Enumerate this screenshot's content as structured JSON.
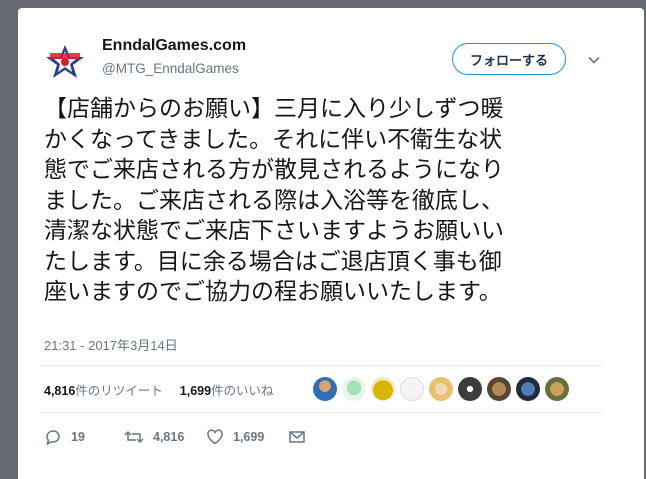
{
  "tweet": {
    "display_name": "EnndalGames.com",
    "handle": "@MTG_EnndalGames",
    "follow_label": "フォローする",
    "text_lines": [
      "【店舗からのお願い】三月に入り少しずつ暖",
      "かくなってきました。それに伴い不衛生な状",
      "態でご来店される方が散見されるようになり",
      "ました。ご来店される際は入浴等を徹底し、",
      "清潔な状態でご来店下さいますようお願いい",
      "たします。目に余る場合はご退店頂く事も御",
      "座いますのでご協力の程お願いいたします。"
    ],
    "timestamp": "21:31 - 2017年3月14日",
    "retweets_count": "4,816",
    "retweets_label": "件のリツイート",
    "likes_count": "1,699",
    "likes_label": "件のいいね",
    "liker_avatars": 9,
    "actions": {
      "reply_count": "19",
      "retweet_count": "4,816",
      "like_count": "1,699"
    }
  },
  "colors": {
    "accent": "#1b95e0",
    "secondary_text": "#657786",
    "primary_text": "#14171a",
    "background": "#666a70"
  },
  "icons": [
    "logo-icon",
    "chevron-down-icon",
    "reply-icon",
    "retweet-icon",
    "like-icon",
    "message-icon"
  ]
}
